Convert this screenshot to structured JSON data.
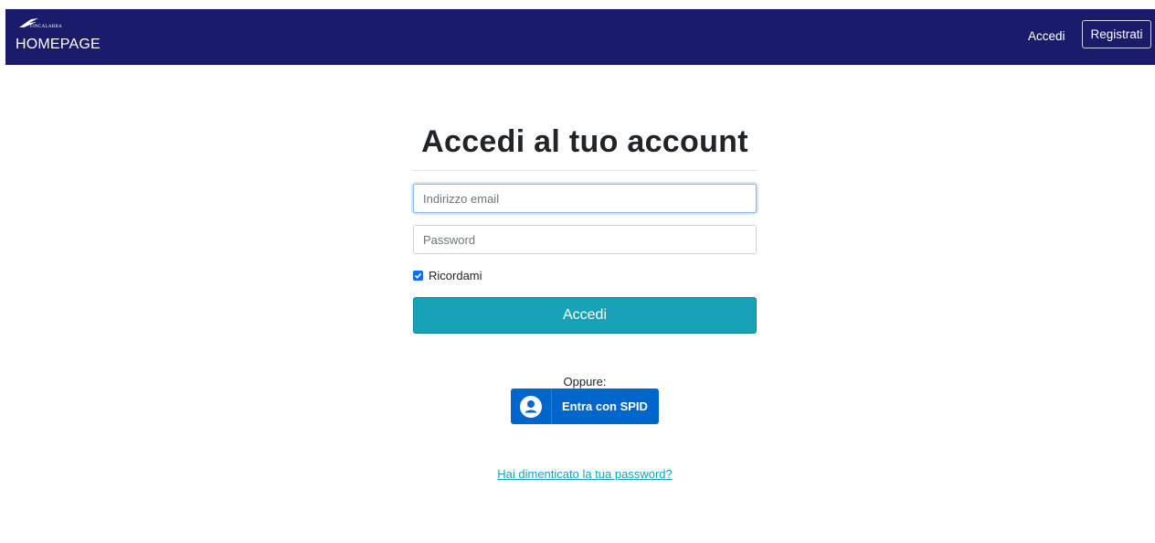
{
  "navbar": {
    "logo_text": "FINCALABRA",
    "brand": "HOMEPAGE",
    "login_link": "Accedi",
    "register_button": "Registrati",
    "background": "#1b1b6b"
  },
  "login": {
    "heading": "Accedi al tuo account",
    "email_placeholder": "Indirizzo email",
    "password_placeholder": "Password",
    "remember_label": "Ricordami",
    "remember_checked": true,
    "submit_label": "Accedi",
    "accent": "#17a2b8"
  },
  "alternative": {
    "or_text": "Oppure:",
    "spid_label": "Entra con SPID",
    "spid_icon": "user-circle-icon",
    "spid_color": "#0066cc"
  },
  "forgot_password": "Hai dimenticato la tua password?"
}
